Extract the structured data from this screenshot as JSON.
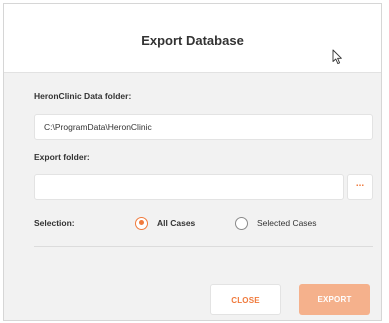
{
  "dialog": {
    "title": "Export Database",
    "data_folder_label": "HeronClinic Data folder:",
    "data_folder_value": "C:\\ProgramData\\HeronClinic",
    "export_folder_label": "Export folder:",
    "export_folder_value": "",
    "browse_label": "...",
    "selection_label": "Selection:",
    "options": [
      {
        "label": "All Cases",
        "selected": true
      },
      {
        "label": "Selected Cases",
        "selected": false
      }
    ],
    "close_label": "CLOSE",
    "export_label": "EXPORT"
  },
  "colors": {
    "accent": "#f07a3c",
    "export_disabled": "#f5b18c",
    "background": "#f2f2f2"
  }
}
